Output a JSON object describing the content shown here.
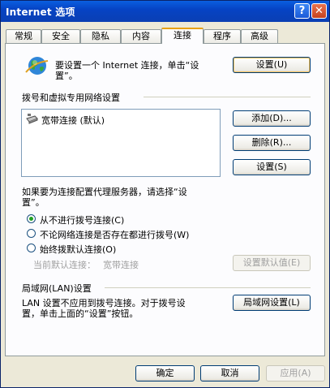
{
  "window": {
    "title": "Internet 选项",
    "help_glyph": "?",
    "close_glyph": "✕"
  },
  "tabs": [
    {
      "label": "常规",
      "active": false
    },
    {
      "label": "安全",
      "active": false
    },
    {
      "label": "隐私",
      "active": false
    },
    {
      "label": "内容",
      "active": false
    },
    {
      "label": "连接",
      "active": true
    },
    {
      "label": "程序",
      "active": false
    },
    {
      "label": "高级",
      "active": false
    }
  ],
  "setup": {
    "text_line1": "要设置一个 Internet 连接，单击“设",
    "text_line2": "置”。",
    "button": "设置(U)"
  },
  "dialup": {
    "group_label": "拨号和虚拟专用网络设置",
    "connections": [
      {
        "label": "宽带连接 (默认)"
      }
    ],
    "add_button": "添加(D)...",
    "remove_button": "删除(R)...",
    "settings_button": "设置(S)",
    "proxy_note_line1": "如果要为连接配置代理服务器，请选择“设",
    "proxy_note_line2": "置”。",
    "options": [
      {
        "label": "从不进行拨号连接(C)",
        "checked": true
      },
      {
        "label": "不论网络连接是否存在都进行拨号(W)",
        "checked": false
      },
      {
        "label": "始终拨默认连接(O)",
        "checked": false
      }
    ],
    "current_default_label": "当前默认连接：",
    "current_default_value": "宽带连接",
    "set_default_button": "设置默认值(E)"
  },
  "lan": {
    "group_label": "局域网(LAN)设置",
    "text_line1": "LAN 设置不应用到拨号连接。对于拨号设",
    "text_line2": "置，单击上面的“设置”按钮。",
    "button": "局域网设置(L)"
  },
  "footer": {
    "ok": "确定",
    "cancel": "取消",
    "apply": "应用(A)"
  }
}
